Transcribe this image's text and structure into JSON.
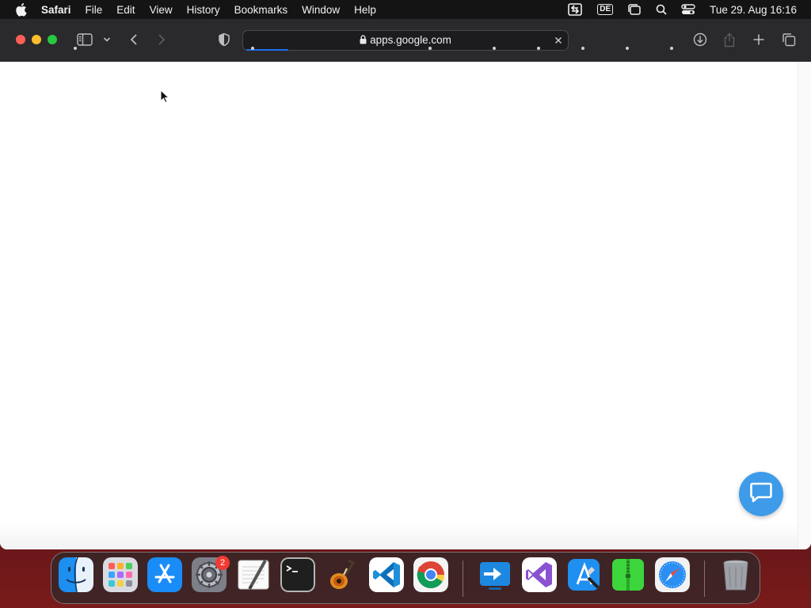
{
  "menubar": {
    "app_name": "Safari",
    "items": [
      "File",
      "Edit",
      "View",
      "History",
      "Bookmarks",
      "Window",
      "Help"
    ],
    "input_language": "DE",
    "clock": "Tue 29. Aug  16:16"
  },
  "browser": {
    "address": "apps.google.com",
    "page_loading_progress": 0.13
  },
  "dock": {
    "apps": [
      "Finder",
      "Launchpad",
      "App Store",
      "System Settings",
      "TextEdit",
      "Terminal",
      "GarageBand",
      "Visual Studio Code",
      "Google Chrome",
      "Remote Desktop",
      "Visual Studio",
      "Xcode Instruments",
      "Archive Utility",
      "Safari"
    ],
    "settings_badge": "2",
    "trash": "Trash"
  },
  "colors": {
    "chat_button": "#3d9bea",
    "progress": "#1d6ff2",
    "close_button": "#fe5f57",
    "minimize_button": "#febc2e",
    "zoom_button": "#28c840"
  }
}
